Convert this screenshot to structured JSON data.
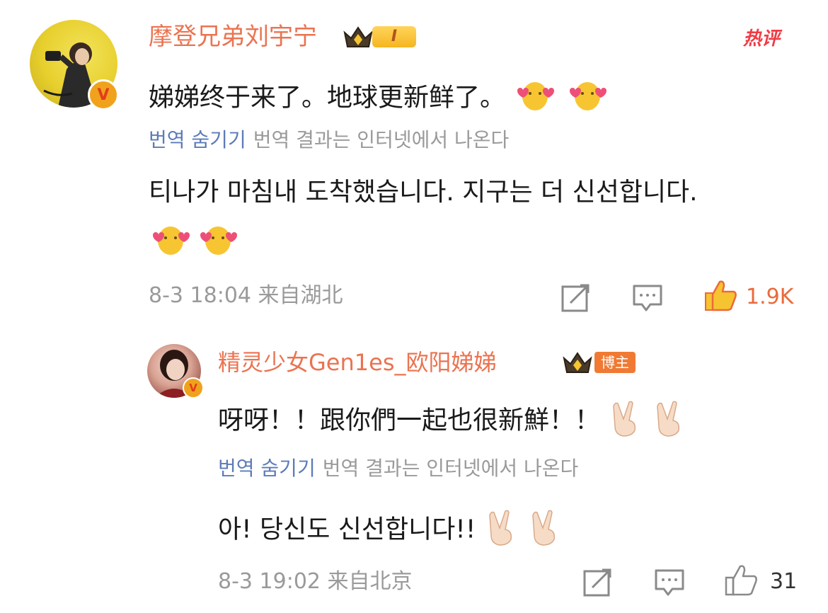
{
  "comment": {
    "username": "摩登兄弟刘宇宁",
    "vip_level": "I",
    "hot_tag": "热评",
    "text": "娣娣终于来了。地球更新鲜了。",
    "translate_link": "번역 숨기기",
    "translate_note": "번역 결과는 인터넷에서 나온다",
    "translation": "티나가 마침내 도착했습니다. 지구는 더 신선합니다.",
    "time": "8-3 18:04",
    "location": "来自湖北",
    "like_count": "1.9K",
    "colors": {
      "username": "#eb7350",
      "like_active": "#eb6a3a",
      "translate_link": "#5d7bb8",
      "meta": "#9a9a9a"
    }
  },
  "reply": {
    "username": "精灵少女Gen1es_欧阳娣娣",
    "host_tag": "博主",
    "text": "呀呀！！跟你們一起也很新鮮！！",
    "translate_link": "번역 숨기기",
    "translate_note": "번역 결과는 인터넷에서 나온다",
    "translation": "아! 당신도 신선합니다!!",
    "time": "8-3 19:02",
    "location": "来自北京",
    "like_count": "31"
  },
  "icons": [
    "crown-icon",
    "verified-icon",
    "hearts-emoji-icon",
    "victory-hand-emoji-icon",
    "repost-icon",
    "comment-icon",
    "like-icon"
  ]
}
